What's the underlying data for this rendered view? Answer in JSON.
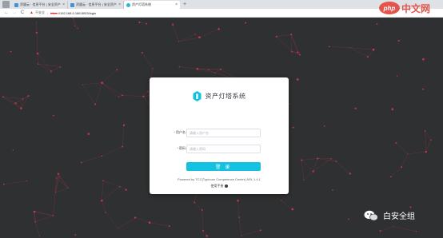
{
  "browser": {
    "tabs": [
      {
        "title": "资盟云 · 信息平台 | 安全资产管理平台",
        "active": false
      },
      {
        "title": "资盟云 · 信息平台 | 安全资产管理平台",
        "active": false
      },
      {
        "title": "资产灯塔系统",
        "active": true
      }
    ],
    "nav": {
      "back": "←",
      "forward": "→",
      "reload": "C"
    },
    "address": {
      "warning_icon": "warning-triangle-icon",
      "security_text": "不安全",
      "scheme": "https",
      "rest": "://192.168.0.186:5003/login"
    }
  },
  "login": {
    "title": "资产灯塔系统",
    "username_label": "用户名:",
    "username_placeholder": "请输入用户名",
    "password_label": "密码:",
    "password_placeholder": "请输入密码",
    "required_mark": "*",
    "submit_label": "登 录",
    "powered_by": "Powered by TCC(Typhoon Competence Center) ARL 1.4.1",
    "help_link": "使用手册"
  },
  "watermarks": {
    "php_logo": "php",
    "php_site": "中文网",
    "wechat_account": "白安全组"
  },
  "colors": {
    "background": "#2f3031",
    "accent": "#13c2e0",
    "network_node": "#ff3b5c"
  }
}
